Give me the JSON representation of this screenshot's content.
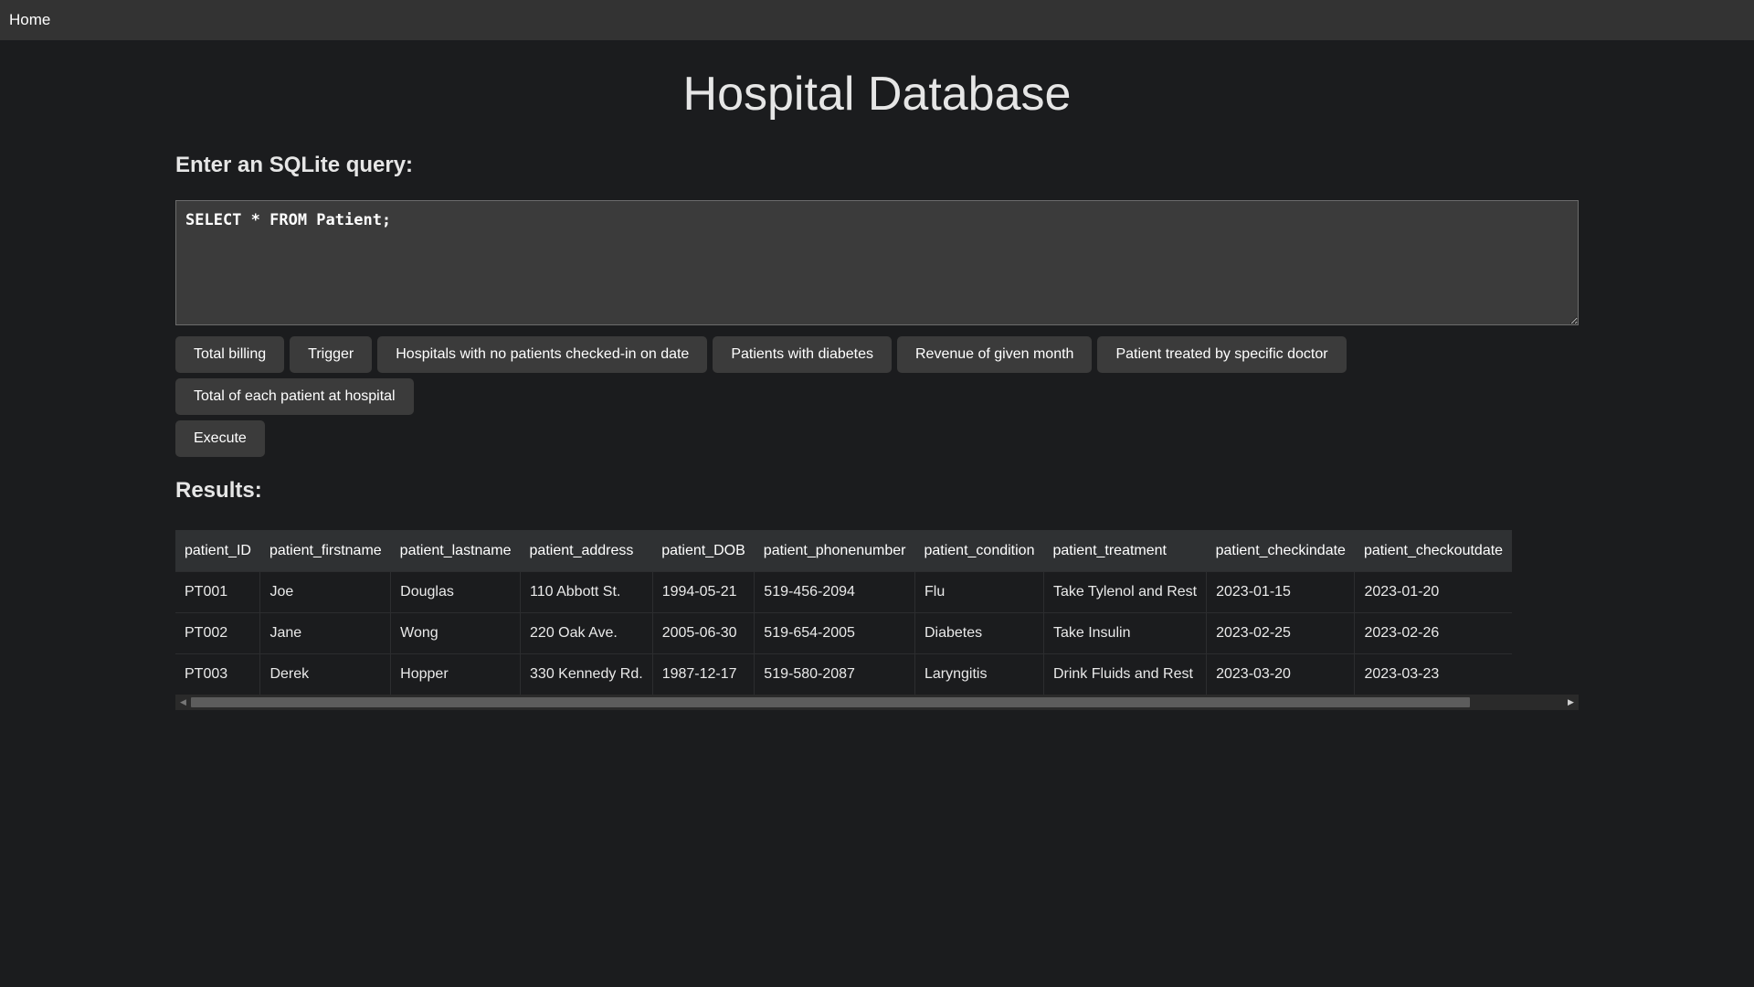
{
  "nav": {
    "home_label": "Home"
  },
  "page": {
    "title": "Hospital Database"
  },
  "query": {
    "label": "Enter an SQLite query:",
    "value": "SELECT * FROM Patient;"
  },
  "buttons": {
    "row1": [
      "Total billing",
      "Trigger",
      "Hospitals with no patients checked-in on date",
      "Patients with diabetes",
      "Revenue of given month",
      "Patient treated by specific doctor"
    ],
    "row2": [
      "Total of each patient at hospital"
    ],
    "execute": "Execute"
  },
  "results": {
    "label": "Results:",
    "columns": [
      "patient_ID",
      "patient_firstname",
      "patient_lastname",
      "patient_address",
      "patient_DOB",
      "patient_phonenumber",
      "patient_condition",
      "patient_treatment",
      "patient_checkindate",
      "patient_checkoutdate"
    ],
    "rows": [
      [
        "PT001",
        "Joe",
        "Douglas",
        "110 Abbott St.",
        "1994-05-21",
        "519-456-2094",
        "Flu",
        "Take Tylenol and Rest",
        "2023-01-15",
        "2023-01-20"
      ],
      [
        "PT002",
        "Jane",
        "Wong",
        "220 Oak Ave.",
        "2005-06-30",
        "519-654-2005",
        "Diabetes",
        "Take Insulin",
        "2023-02-25",
        "2023-02-26"
      ],
      [
        "PT003",
        "Derek",
        "Hopper",
        "330 Kennedy Rd.",
        "1987-12-17",
        "519-580-2087",
        "Laryngitis",
        "Drink Fluids and Rest",
        "2023-03-20",
        "2023-03-23"
      ]
    ],
    "scroll_position": 0.0
  },
  "icons": {
    "scroll_left": "scroll-left-arrow-icon",
    "scroll_right": "scroll-right-arrow-icon"
  }
}
